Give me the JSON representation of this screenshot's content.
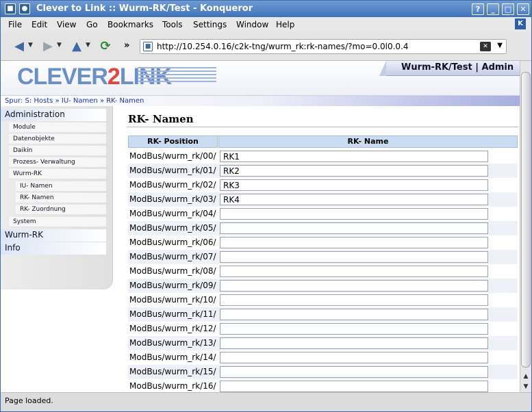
{
  "window": {
    "title": "Clever to Link :: Wurm-RK/Test - Konqueror"
  },
  "menu": [
    {
      "label": "File"
    },
    {
      "label": "Edit"
    },
    {
      "label": "View"
    },
    {
      "label": "Go"
    },
    {
      "label": "Bookmarks"
    },
    {
      "label": "Tools"
    },
    {
      "label": "Settings"
    },
    {
      "label": "Window"
    },
    {
      "label": "Help"
    }
  ],
  "toolbar": {
    "url": "http://10.254.0.16/c2k-tng/wurm_rk:rk-names/?mo=0.0l0.0.4"
  },
  "header": {
    "logo_a": "CLEVER",
    "logo_b": "2",
    "logo_c": "LINK",
    "context": "Wurm-RK/Test",
    "separator": "|",
    "user": "Admin"
  },
  "breadcrumb": "Spur: S: Hosts  » IU- Namen  » RK- Namen",
  "sidebar": {
    "administration": "Administration",
    "items": [
      "Module",
      "Datenobjekte",
      "Daikin",
      "Prozess- Verwaltung",
      "Wurm-RK"
    ],
    "subitems": [
      "IU- Namen",
      "RK- Namen",
      "RK- Zuordnung"
    ],
    "system": "System",
    "wurm_rk": "Wurm-RK",
    "info": "Info"
  },
  "main": {
    "title": "RK- Namen",
    "col_position": "RK- Position",
    "col_name": "RK- Name",
    "rows": [
      {
        "pos": "ModBus/wurm_rk/00/",
        "name": "RK1"
      },
      {
        "pos": "ModBus/wurm_rk/01/",
        "name": "RK2"
      },
      {
        "pos": "ModBus/wurm_rk/02/",
        "name": "RK3"
      },
      {
        "pos": "ModBus/wurm_rk/03/",
        "name": "RK4"
      },
      {
        "pos": "ModBus/wurm_rk/04/",
        "name": ""
      },
      {
        "pos": "ModBus/wurm_rk/05/",
        "name": ""
      },
      {
        "pos": "ModBus/wurm_rk/06/",
        "name": ""
      },
      {
        "pos": "ModBus/wurm_rk/07/",
        "name": ""
      },
      {
        "pos": "ModBus/wurm_rk/08/",
        "name": ""
      },
      {
        "pos": "ModBus/wurm_rk/09/",
        "name": ""
      },
      {
        "pos": "ModBus/wurm_rk/10/",
        "name": ""
      },
      {
        "pos": "ModBus/wurm_rk/11/",
        "name": ""
      },
      {
        "pos": "ModBus/wurm_rk/12/",
        "name": ""
      },
      {
        "pos": "ModBus/wurm_rk/13/",
        "name": ""
      },
      {
        "pos": "ModBus/wurm_rk/14/",
        "name": ""
      },
      {
        "pos": "ModBus/wurm_rk/15/",
        "name": ""
      },
      {
        "pos": "ModBus/wurm_rk/16/",
        "name": ""
      }
    ]
  },
  "status": "Page loaded.",
  "colors": {
    "title_bar": "#3f72b8",
    "logo_blue": "#6b8fc9",
    "logo_red": "#e3473b",
    "table_header": "#c9dcf1"
  }
}
